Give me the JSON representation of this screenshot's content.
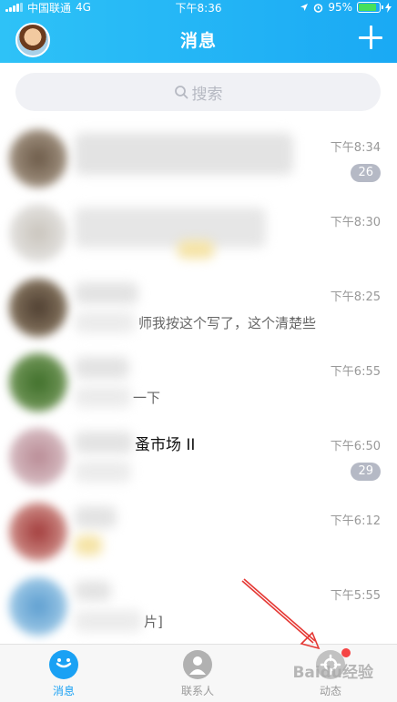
{
  "status_bar": {
    "carrier": "中国联通",
    "network": "4G",
    "time": "下午8:36",
    "battery_percent": "95%",
    "battery_level": 0.95,
    "battery_color": "#46e05b"
  },
  "header": {
    "title": "消息",
    "avatar_icon": "user-avatar",
    "add_icon": "plus-icon"
  },
  "search": {
    "placeholder": "搜索",
    "icon": "search-icon"
  },
  "conversations": [
    {
      "name": "",
      "preview": "",
      "time": "下午8:34",
      "badge": "26"
    },
    {
      "name": "",
      "preview": "",
      "time": "下午8:30",
      "badge": ""
    },
    {
      "name": "",
      "preview": "师我按这个写了，这个清楚些",
      "time": "下午8:25",
      "badge": ""
    },
    {
      "name": "",
      "preview": "一下",
      "time": "下午6:55",
      "badge": ""
    },
    {
      "name": "蚤市场 II",
      "preview": "",
      "time": "下午6:50",
      "badge": "29"
    },
    {
      "name": "",
      "preview": "",
      "time": "下午6:12",
      "badge": ""
    },
    {
      "name": "",
      "preview": "片]",
      "time": "下午5:55",
      "badge": ""
    }
  ],
  "tab_bar": {
    "tabs": [
      {
        "label": "消息",
        "icon": "chat-bubble-icon",
        "active": true
      },
      {
        "label": "联系人",
        "icon": "contacts-icon",
        "active": false
      },
      {
        "label": "动态",
        "icon": "moments-icon",
        "active": false
      }
    ]
  },
  "watermark": "Baidu经验",
  "colors": {
    "accent": "#1aa9f4",
    "badge": "#b5b9c5",
    "notification_dot": "#f54545",
    "annotation_arrow": "#e53935"
  }
}
